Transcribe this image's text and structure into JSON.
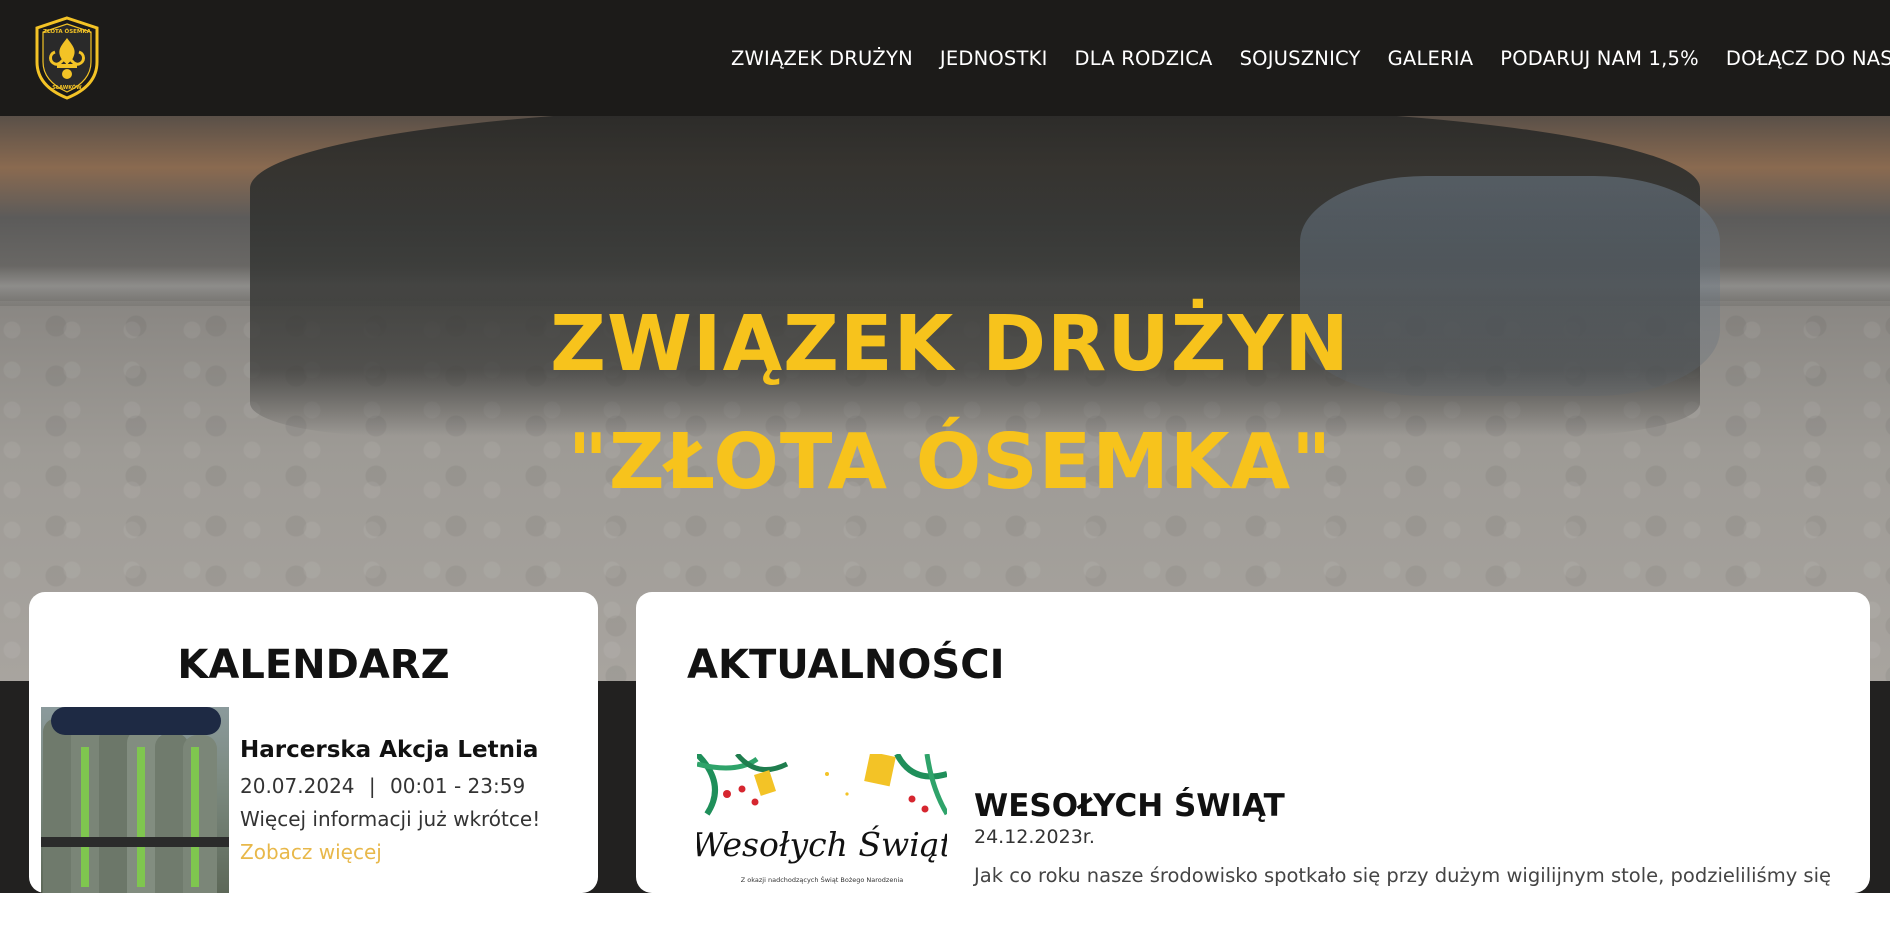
{
  "header": {
    "logo_text": "ZŁOTA ÓSEMKA",
    "logo_subtext": "SŁAWKÓW",
    "nav": [
      {
        "label": "ZWIĄZEK DRUŻYN"
      },
      {
        "label": "JEDNOSTKI"
      },
      {
        "label": "DLA RODZICA"
      },
      {
        "label": "SOJUSZNICY"
      },
      {
        "label": "GALERIA"
      },
      {
        "label": "PODARUJ NAM 1,5%"
      },
      {
        "label": "DOŁĄCZ DO NAS"
      }
    ]
  },
  "hero": {
    "title_line1": "ZWIĄZEK DRUŻYN",
    "title_line2": "\"ZŁOTA ÓSEMKA\"",
    "title_color": "#f7c31c"
  },
  "calendar": {
    "title": "KALENDARZ",
    "event": {
      "title": "Harcerska Akcja Letnia",
      "date": "20.07.2024",
      "separator": "|",
      "time": "00:01 - 23:59",
      "description": "Więcej informacji już wkrótce!",
      "link_label": "Zobacz więcej",
      "link_color": "#e8b84a"
    }
  },
  "news": {
    "title": "AKTUALNOŚCI",
    "item": {
      "image_text": "Wesołych Świąt",
      "image_caption": "Z okazji nadchodzących Świąt Bożego Narodzenia",
      "title": "WESOŁYCH ŚWIĄT",
      "date": "24.12.2023r.",
      "excerpt": "Jak co roku nasze środowisko spotkało się przy dużym wigilijnym stole, podzieliliśmy się"
    }
  },
  "colors": {
    "header_bg": "#1c1b19",
    "accent": "#f7c31c",
    "band_bg": "#222120"
  }
}
